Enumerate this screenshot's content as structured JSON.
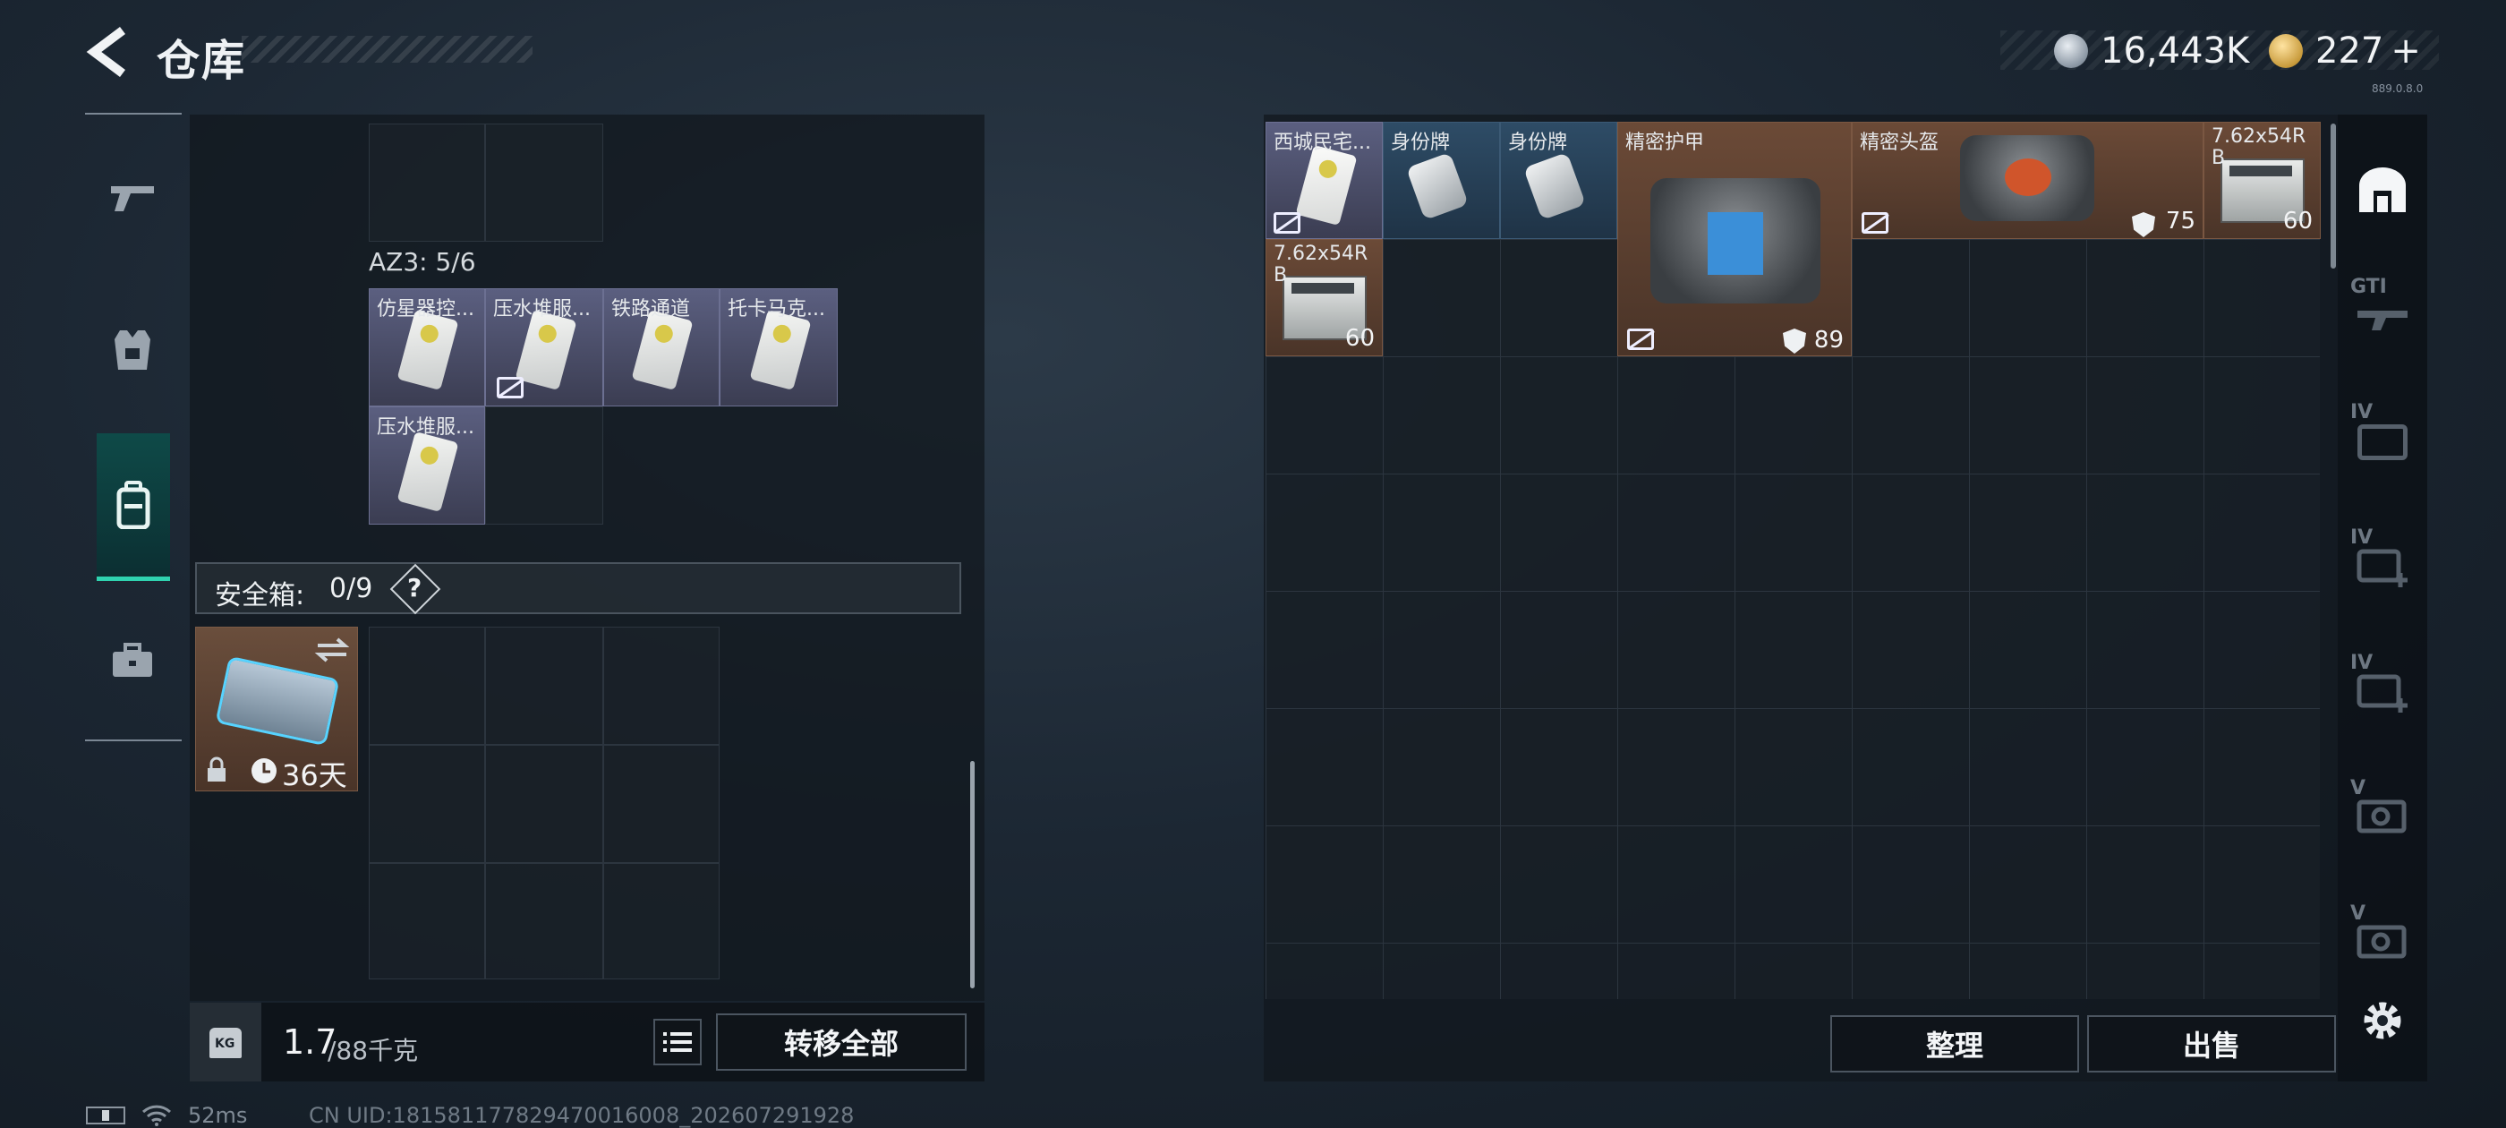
{
  "header": {
    "title": "仓库"
  },
  "currency": {
    "silver": "16,443K",
    "gold": "227",
    "gold_add": "+",
    "version": "889.0.8.0"
  },
  "left_nav": [
    {
      "name": "weapon"
    },
    {
      "name": "armor"
    },
    {
      "name": "backpack",
      "active": true
    },
    {
      "name": "case"
    }
  ],
  "backpack": {
    "container_label": "AZ3: 5/6",
    "items": [
      {
        "name": "仿星器控..."
      },
      {
        "name": "压水堆服..."
      },
      {
        "name": "铁路通道"
      },
      {
        "name": "托卡马克..."
      },
      {
        "name": "压水堆服..."
      }
    ]
  },
  "safebox": {
    "label": "安全箱:",
    "count": "0/9",
    "help": "?",
    "days": "36天"
  },
  "weight": {
    "value": "1.7",
    "max": "/88千克",
    "kg_badge": "KG"
  },
  "buttons": {
    "transfer_all": "转移全部",
    "sort": "整理",
    "sell": "出售"
  },
  "stash": {
    "items": [
      {
        "name": "西城民宅..."
      },
      {
        "name": "身份牌"
      },
      {
        "name": "身份牌"
      },
      {
        "name": "精密护甲",
        "durability": "89"
      },
      {
        "name": "精密头盔",
        "durability": "75"
      },
      {
        "name": "7.62x54R B",
        "count": "60"
      },
      {
        "name": "7.62x54R B",
        "count": "60"
      }
    ]
  },
  "side_tabs": [
    {
      "label": "GTI"
    },
    {
      "label": "IV"
    },
    {
      "label": "IV"
    },
    {
      "label": "IV"
    },
    {
      "label": "V"
    },
    {
      "label": "V"
    }
  ],
  "status": {
    "ping": "52ms",
    "uid": "CN UID:1815811778294700​16008_202607291928"
  }
}
